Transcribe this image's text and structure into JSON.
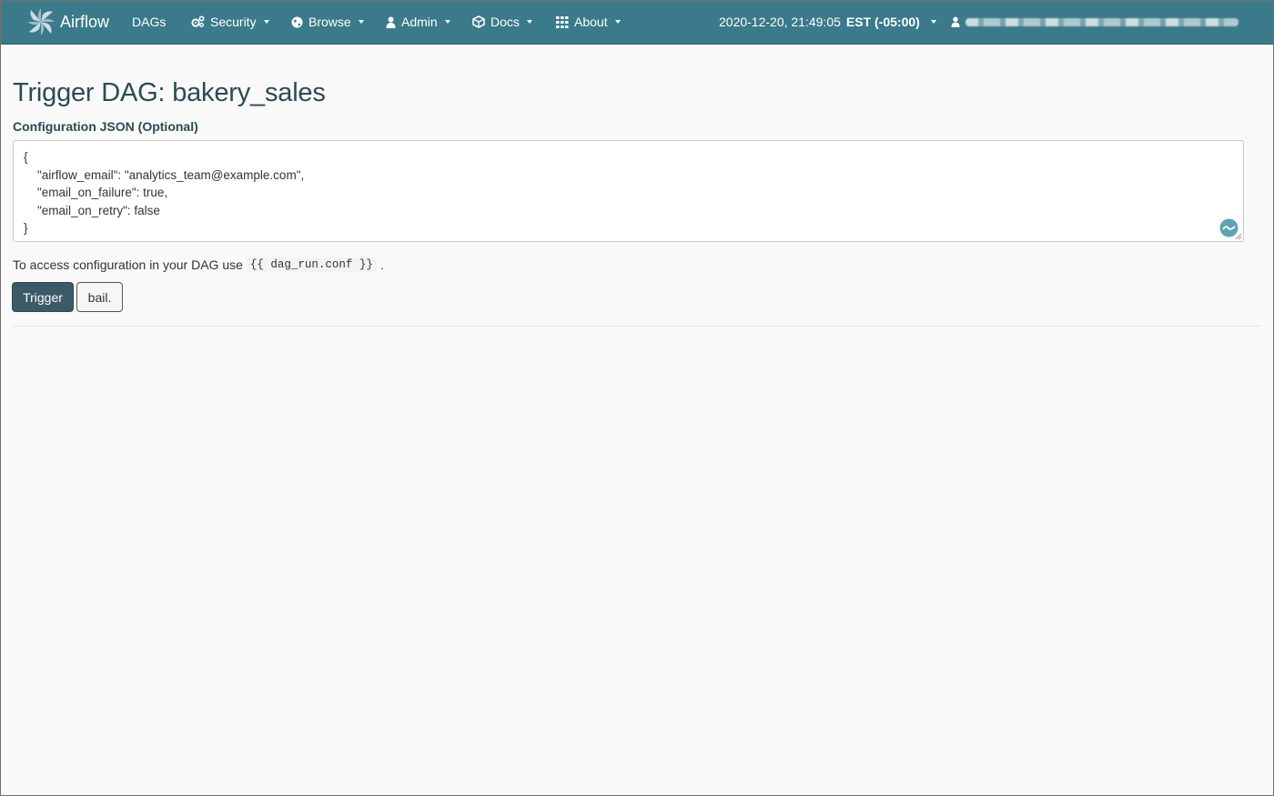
{
  "navbar": {
    "brand": "Airflow",
    "items": [
      {
        "label": "DAGs",
        "icon": "none",
        "dropdown": false
      },
      {
        "label": "Security",
        "icon": "cogs-icon",
        "dropdown": true
      },
      {
        "label": "Browse",
        "icon": "globe-icon",
        "dropdown": true
      },
      {
        "label": "Admin",
        "icon": "user-icon",
        "dropdown": true
      },
      {
        "label": "Docs",
        "icon": "cube-icon",
        "dropdown": true
      },
      {
        "label": "About",
        "icon": "grid-icon",
        "dropdown": true
      }
    ],
    "clock_time": "2020-12-20, 21:49:05",
    "clock_tz": "EST (-05:00)",
    "user": "redacted"
  },
  "page": {
    "title": "Trigger DAG: bakery_sales",
    "conf_label": "Configuration JSON (Optional)",
    "conf_value": "{\n    \"airflow_email\": \"analytics_team@example.com\",\n    \"email_on_failure\": true,\n    \"email_on_retry\": false\n}",
    "hint_prefix": "To access configuration in your DAG use",
    "hint_code": "{{ dag_run.conf }}",
    "hint_suffix": ".",
    "trigger_label": "Trigger",
    "bail_label": "bail."
  },
  "colors": {
    "navbar": "#3a7a8a",
    "trigger_button": "#3c5a66",
    "title": "#2d4a52"
  }
}
